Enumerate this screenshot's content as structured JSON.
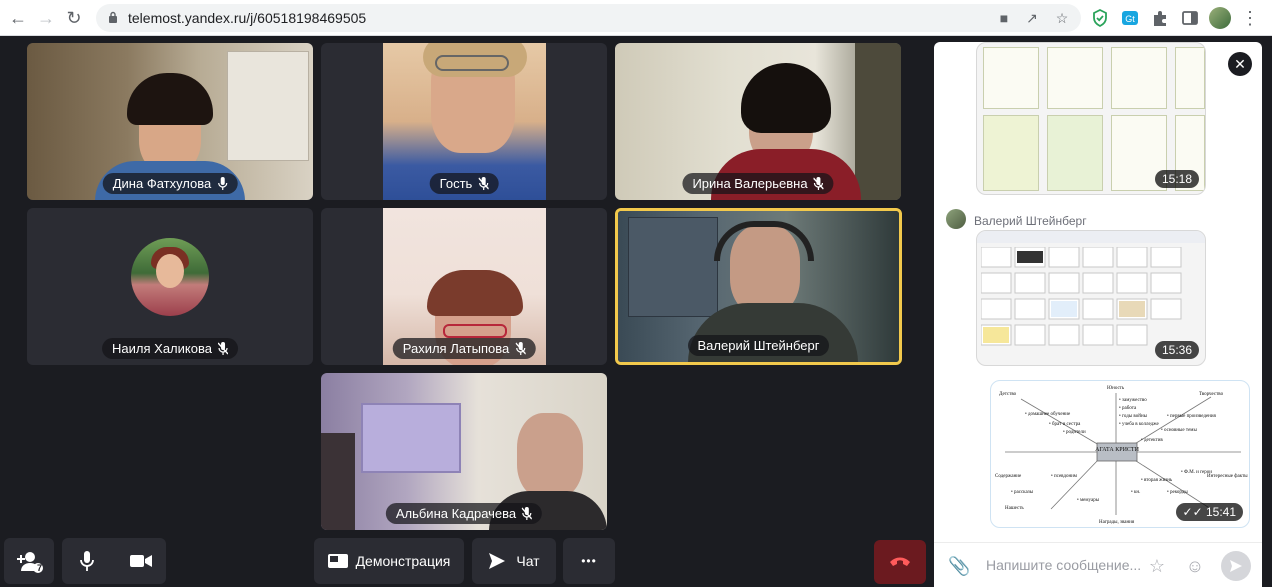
{
  "browser": {
    "url": "telemost.yandex.ru/j/60518198469505",
    "back_icon": "arrow-left-icon",
    "forward_icon": "arrow-right-icon",
    "reload_icon": "reload-icon"
  },
  "participants": [
    {
      "name": "Дина Фатхулова",
      "muted": false
    },
    {
      "name": "Гость",
      "muted": true
    },
    {
      "name": "Ирина Валерьевна",
      "muted": true
    },
    {
      "name": "Наиля Халикова",
      "muted": true
    },
    {
      "name": "Рахиля Латыпова",
      "muted": true
    },
    {
      "name": "Валерий Штейнберг",
      "muted": false,
      "active_speaker": true
    },
    {
      "name": "Альбина Кадрачева",
      "muted": true
    }
  ],
  "toolbar": {
    "participants_count": "7",
    "demo_label": "Демонстрация",
    "chat_label": "Чат",
    "more_label": "•••"
  },
  "chat": {
    "messages": [
      {
        "type": "image",
        "time": "15:18"
      },
      {
        "type": "image",
        "sender": "Валерий Штейнберг",
        "time": "15:36"
      },
      {
        "type": "image",
        "time": "15:41",
        "read": true,
        "diagram": {
          "center": "АГАТА КРИСТИ",
          "labels": [
            "Детство",
            "Юность",
            "Творчество",
            "Содержание",
            "Интересные факты",
            "Нашесть",
            "Награды, звания",
            "• домашнее обучение",
            "• брат и сестра",
            "• родители",
            "• замужество",
            "• работа",
            "• годы войны",
            "• учеба в колледже",
            "• первые произведения",
            "• основные темы",
            "• детектив",
            "• Ф.М. и герои",
            "• вторая жизнь",
            "• кн.",
            "• рекорды",
            "• мемуары",
            "• псевдоним",
            "• рассказы"
          ]
        }
      }
    ],
    "input_placeholder": "Напишите сообщение..."
  }
}
